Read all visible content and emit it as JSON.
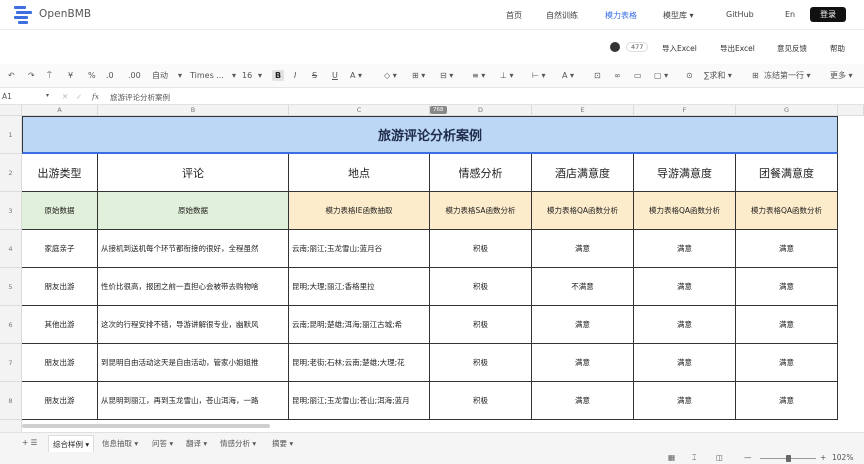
{
  "nav": {
    "logo": "OpenBMB",
    "links": [
      "首页",
      "自然训练",
      "模力表格",
      "模型库 ▾",
      "GitHub",
      "En"
    ],
    "active_index": 2,
    "login": "登录"
  },
  "subbar": {
    "star_count": "477",
    "items": [
      "导入Excel",
      "导出Excel",
      "意见反馈",
      "帮助"
    ]
  },
  "toolbar": {
    "items": [
      "↶",
      "↷",
      "⍑",
      "¥",
      "%",
      ".0",
      ".00",
      "自动",
      "▾",
      "Times ...",
      "▾",
      "16",
      "▾",
      "B",
      "I",
      "S",
      "U",
      "A ▾",
      "◇ ▾",
      "⊞ ▾",
      "⊟ ▾",
      "≡ ▾",
      "⊥ ▾",
      "⊢ ▾",
      "A ▾",
      "⊡",
      "∞",
      "▭",
      "▢ ▾",
      "⊙",
      "∑求和 ▾",
      "⊞",
      "冻结第一行 ▾",
      "更多 ▾"
    ]
  },
  "formula_bar": {
    "cell_ref": "A1",
    "content": "旅游评论分析案例"
  },
  "grid": {
    "columns": [
      "A",
      "B",
      "C",
      "D",
      "E",
      "F",
      "G"
    ],
    "row_numbers": [
      "1",
      "2",
      "3",
      "4",
      "5",
      "6",
      "7",
      "8"
    ],
    "row_badge": "768",
    "title": "旅游评论分析案例",
    "headers": [
      "出游类型",
      "评论",
      "地点",
      "情感分析",
      "酒店满意度",
      "导游满意度",
      "团餐满意度"
    ],
    "types": [
      "原始数据",
      "原始数据",
      "模力表格IE函数抽取",
      "模力表格SA函数分析",
      "模力表格QA函数分析",
      "模力表格QA函数分析",
      "模力表格QA函数分析"
    ],
    "rows": [
      [
        "家庭亲子",
        "从接机到送机每个环节都衔接的很好，全程虽然",
        "云南;丽江;玉龙雪山;蓝月谷",
        "积极",
        "满意",
        "满意",
        "满意"
      ],
      [
        "朋友出游",
        "性价比很高，报团之前一直担心会被带去购物啥",
        "昆明;大理;丽江;香格里拉",
        "积极",
        "不满意",
        "满意",
        "满意"
      ],
      [
        "其他出游",
        "这次的行程安排不错，导游讲解很专业，幽默风",
        "云南;昆明;楚雄;洱海;丽江古城;希",
        "积极",
        "满意",
        "满意",
        "满意"
      ],
      [
        "朋友出游",
        "到昆明自由活动这天是自由活动，管家小姐姐推",
        "昆明;老街;石林;云南;楚雄;大理;花",
        "积极",
        "满意",
        "满意",
        "满意"
      ],
      [
        "朋友出游",
        "从昆明到丽江，再到玉龙雪山，苍山洱海，一路",
        "昆明;丽江;玉龙雪山;苍山;洱海;蓝月",
        "积极",
        "满意",
        "满意",
        "满意"
      ]
    ]
  },
  "sheet_tabs": {
    "add": "+ ☰",
    "tabs": [
      "综合样例 ▾",
      "信息抽取 ▾",
      "问答 ▾",
      "翻译 ▾",
      "情感分析 ▾",
      "摘要 ▾"
    ],
    "active_index": 0
  },
  "status": {
    "icons": [
      "▦",
      "⌶",
      "◫",
      "—",
      "+"
    ],
    "zoom": "102%"
  }
}
